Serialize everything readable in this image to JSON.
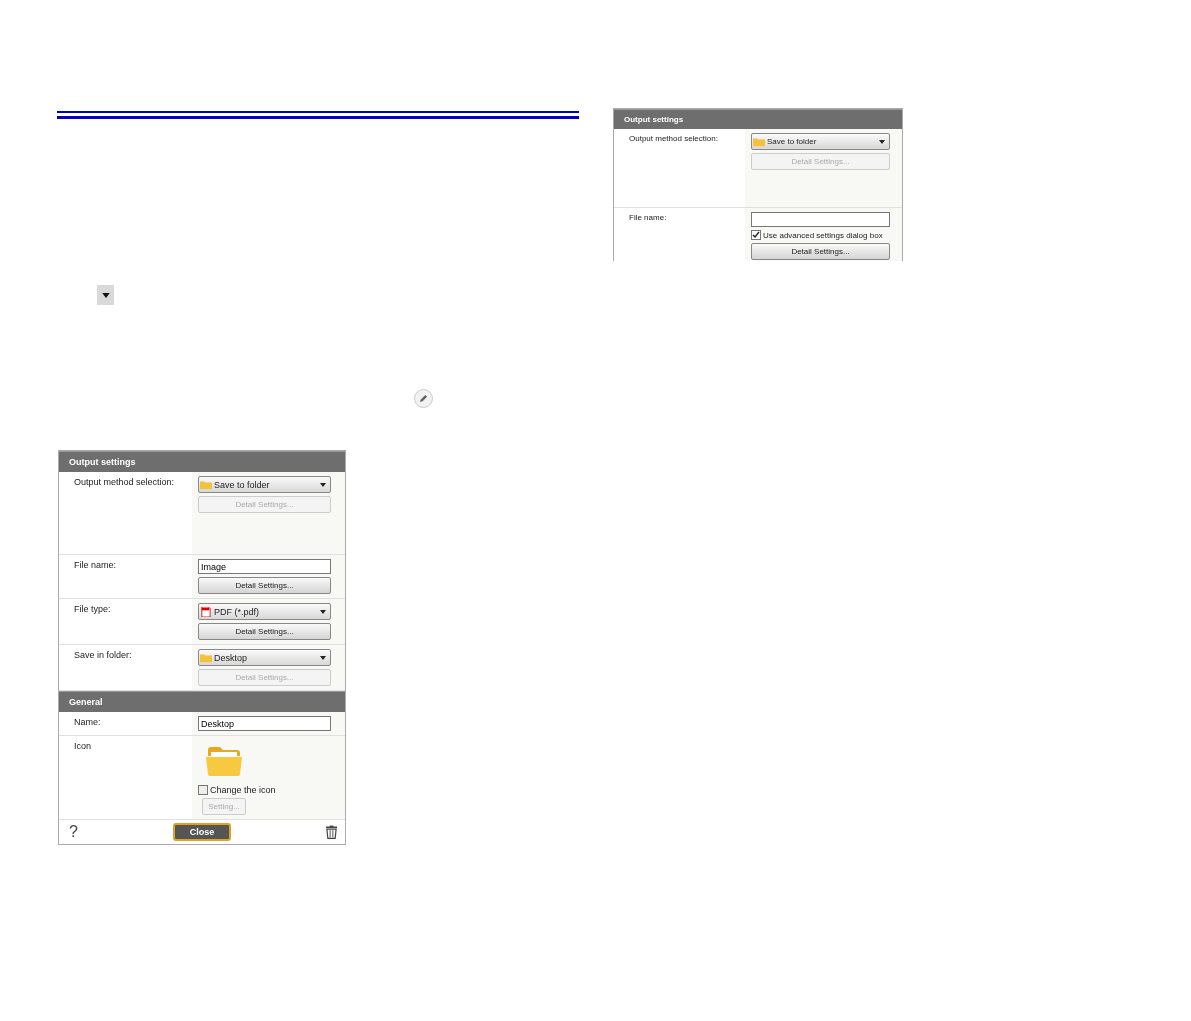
{
  "main_dialog": {
    "sections": [
      {
        "title": "Output settings",
        "rows": [
          {
            "label": "Output method selection:",
            "controls": [
              {
                "kind": "folder_dropdown",
                "value": "Save to folder"
              },
              {
                "kind": "button",
                "label": "Detail Settings...",
                "disabled": true
              }
            ]
          },
          {
            "label": "File name:",
            "controls": [
              {
                "kind": "textfield",
                "value": "Image"
              },
              {
                "kind": "button",
                "label": "Detail Settings...",
                "disabled": false
              }
            ]
          },
          {
            "label": "File type:",
            "controls": [
              {
                "kind": "document_dropdown",
                "value": "PDF (*.pdf)"
              },
              {
                "kind": "button",
                "label": "Detail Settings...",
                "disabled": false
              }
            ]
          },
          {
            "label": "Save in folder:",
            "controls": [
              {
                "kind": "folder_dropdown",
                "value": "Desktop"
              },
              {
                "kind": "button",
                "label": "Detail Settings...",
                "disabled": true
              }
            ]
          }
        ]
      },
      {
        "title": "General",
        "rows": [
          {
            "label": "Name:",
            "controls": [
              {
                "kind": "textfield",
                "value": "Desktop"
              }
            ]
          },
          {
            "label": "Icon",
            "controls": [
              {
                "kind": "large_icon"
              },
              {
                "kind": "checkbox",
                "label": "Change the icon",
                "checked": false
              },
              {
                "kind": "small_button",
                "label": "Setting...",
                "disabled": true
              }
            ]
          }
        ]
      }
    ],
    "footer": {
      "help": "?",
      "close": "Close"
    }
  },
  "detail_dialog": {
    "sections": [
      {
        "title": "Output settings",
        "rows": [
          {
            "label": "Output method selection:",
            "controls": [
              {
                "kind": "folder_dropdown",
                "value": "Save to folder"
              },
              {
                "kind": "button",
                "label": "Detail Settings...",
                "disabled": true
              }
            ]
          },
          {
            "label": "File name:",
            "controls": [
              {
                "kind": "textfield"
              },
              {
                "kind": "checkbox",
                "label": "Use advanced settings dialog box",
                "checked": true
              },
              {
                "kind": "button",
                "label": "Detail Settings...",
                "disabled": false
              }
            ]
          }
        ]
      }
    ]
  }
}
